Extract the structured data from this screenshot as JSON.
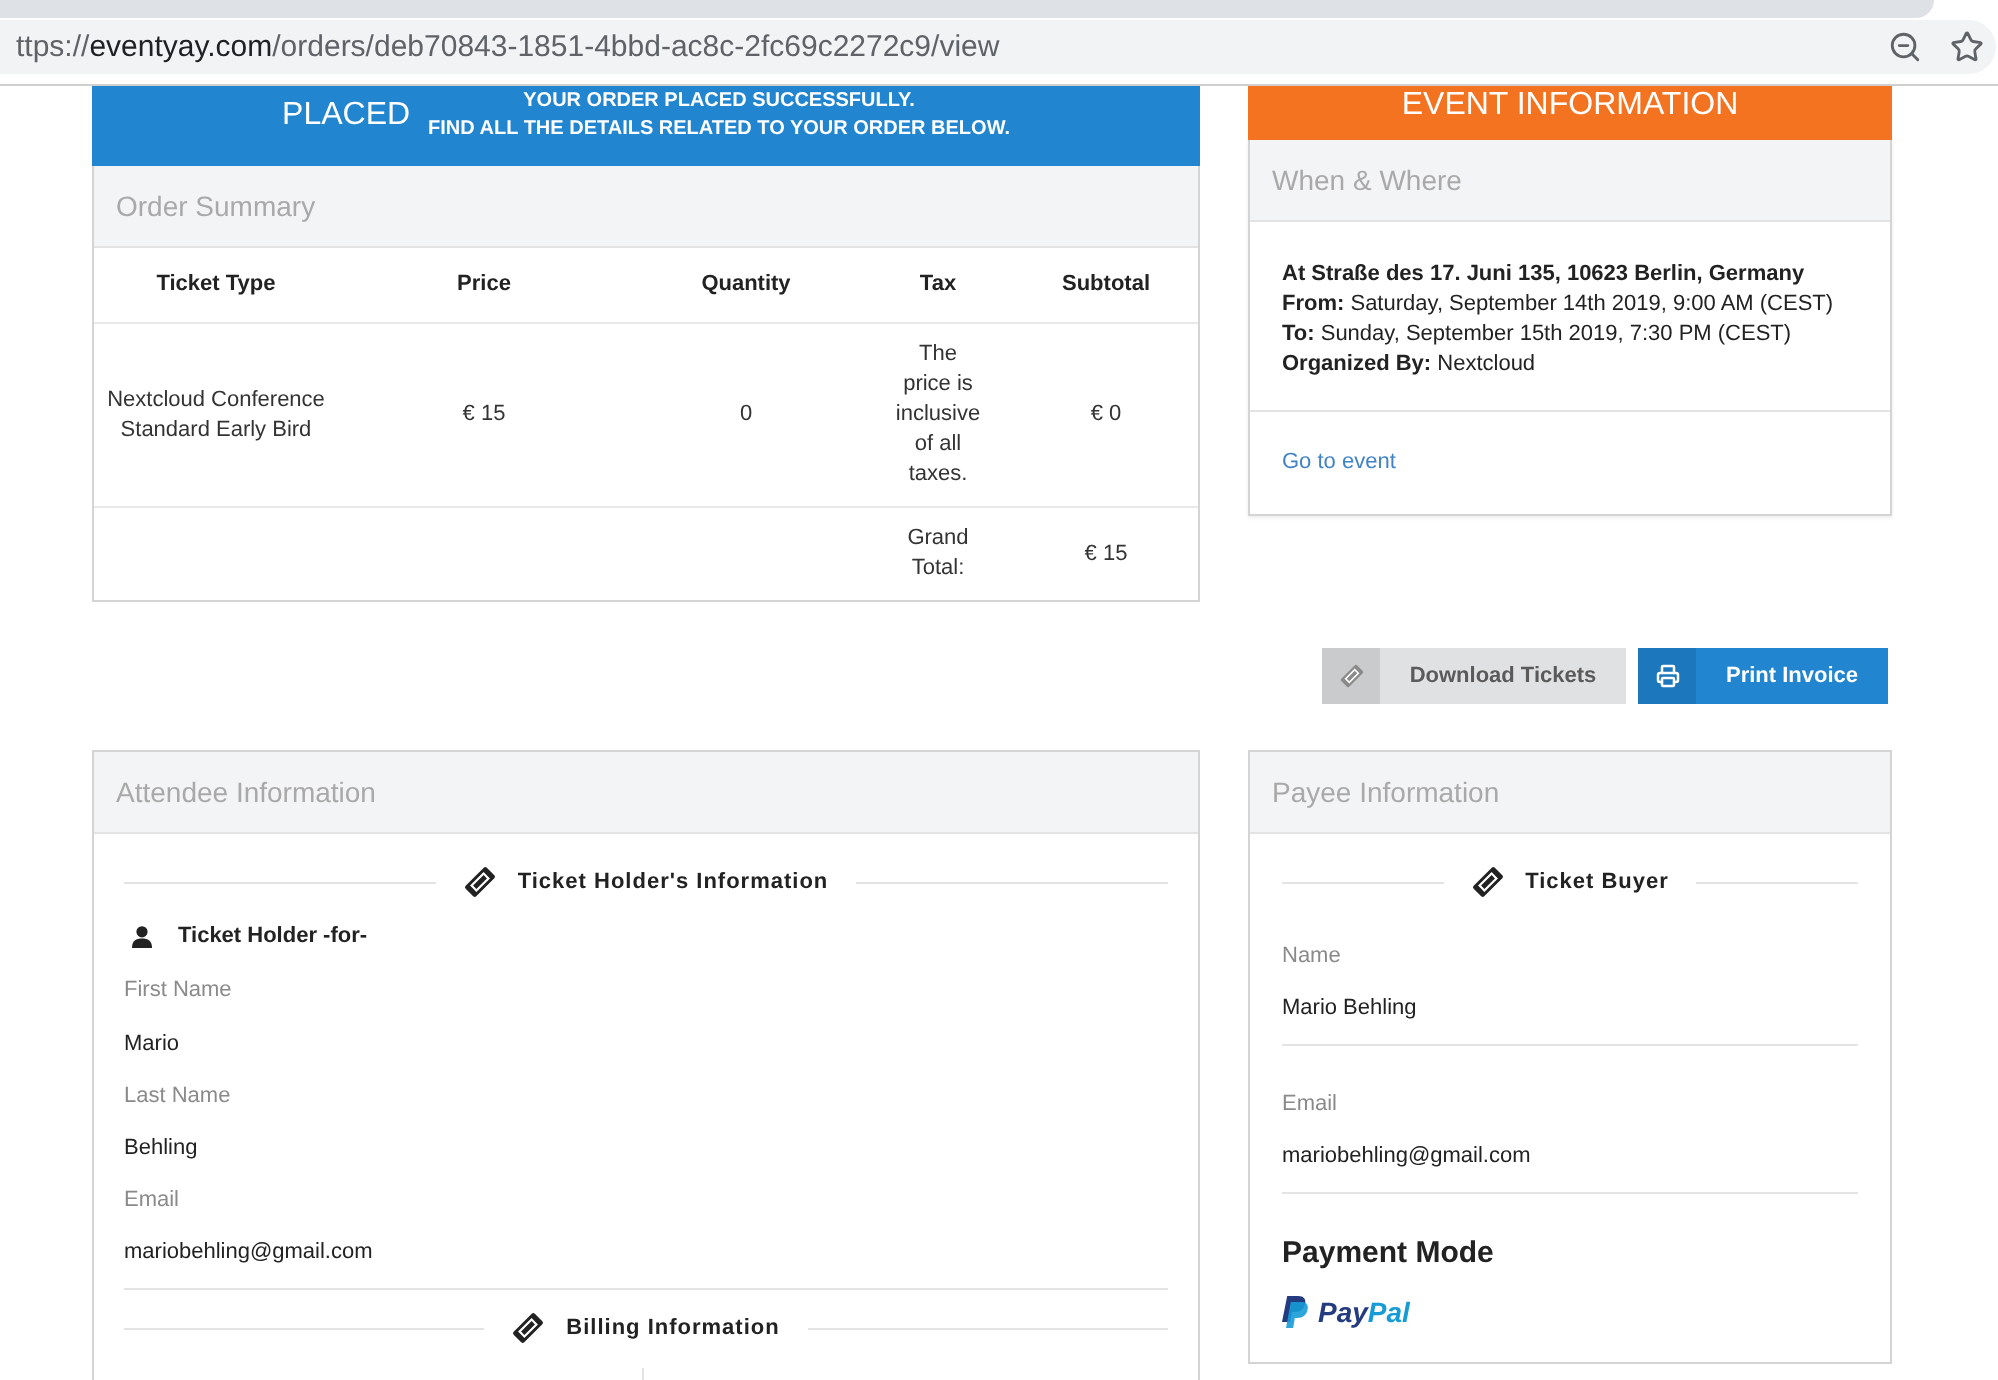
{
  "browser": {
    "url": {
      "prefix": "ttps://",
      "domain": "eventyay.com",
      "path": "/orders/deb70843-1851-4bbd-ac8c-2fc69c2272c9/view"
    }
  },
  "order_banner": {
    "status": "PLACED",
    "message_lines": [
      "YOUR ORDER PLACED SUCCESSFULLY.",
      "FIND ALL THE DETAILS RELATED TO YOUR ORDER BELOW."
    ]
  },
  "order_summary": {
    "title": "Order Summary",
    "columns": [
      "Ticket Type",
      "Price",
      "Quantity",
      "Tax",
      "Subtotal"
    ],
    "rows": [
      {
        "kind": "item",
        "cells": [
          "Nextcloud Conference Standard Early Bird",
          "€ 15",
          "0",
          "The price is inclusive of all taxes.",
          "€ 0"
        ]
      },
      {
        "kind": "total",
        "label": "Grand Total:",
        "amount": "€ 15"
      }
    ]
  },
  "event_information": {
    "banner": "EVENT INFORMATION",
    "title": "When & Where",
    "location": "At Straße des 17. Juni 135, 10623 Berlin, Germany",
    "details": [
      "**From:** Saturday, September 14th 2019, 9:00 AM (CEST)",
      "**To:** Sunday, September 15th 2019, 7:30 PM (CEST)",
      "**Organized By:** Nextcloud"
    ],
    "link": "Go to event"
  },
  "actions": [
    {
      "kind": "download",
      "label": "Download Tickets"
    },
    {
      "kind": "print",
      "label": "Print Invoice"
    }
  ],
  "attendee_information": {
    "title": "Attendee Information",
    "sections": [
      {
        "kind": "ticket_holder",
        "heading": "Ticket Holder's Information",
        "holder": "Ticket Holder -for-",
        "fields": [
          {
            "label": "First Name",
            "value": "Mario"
          },
          {
            "label": "Last Name",
            "value": "Behling"
          },
          {
            "label": "Email",
            "value": "mariobehling@gmail.com"
          }
        ]
      },
      {
        "kind": "billing",
        "heading": "Billing Information"
      }
    ]
  },
  "payee_information": {
    "title": "Payee Information",
    "heading": "Ticket Buyer",
    "fields": [
      {
        "label": "Name",
        "value": "Mario Behling"
      },
      {
        "label": "Email",
        "value": "mariobehling@gmail.com"
      }
    ],
    "payment_mode": {
      "title": "Payment Mode",
      "logo_parts": [
        "Pay",
        "Pal"
      ]
    }
  }
}
